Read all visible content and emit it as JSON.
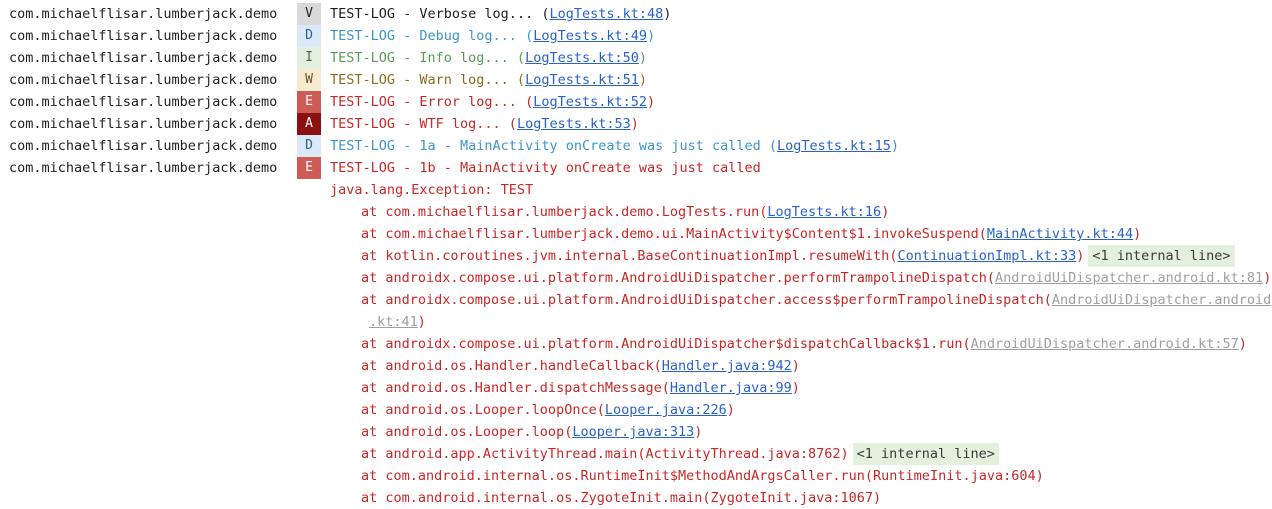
{
  "colors": {
    "error_text": "#c62828",
    "link_blue": "#2a62c9",
    "link_gray": "#a0a0a0",
    "internal_badge_bg": "#e3f1dc"
  },
  "log_rows": [
    {
      "package": "com.michaelflisar.lumberjack.demo",
      "level": "V",
      "message": "TEST-LOG - Verbose log... (",
      "link": "LogTests.kt:48",
      "suffix": ")"
    },
    {
      "package": "com.michaelflisar.lumberjack.demo",
      "level": "D",
      "message": "TEST-LOG - Debug log... (",
      "link": "LogTests.kt:49",
      "suffix": ")"
    },
    {
      "package": "com.michaelflisar.lumberjack.demo",
      "level": "I",
      "message": "TEST-LOG - Info log... (",
      "link": "LogTests.kt:50",
      "suffix": ")"
    },
    {
      "package": "com.michaelflisar.lumberjack.demo",
      "level": "W",
      "message": "TEST-LOG - Warn log... (",
      "link": "LogTests.kt:51",
      "suffix": ")"
    },
    {
      "package": "com.michaelflisar.lumberjack.demo",
      "level": "E",
      "message": "TEST-LOG - Error log... (",
      "link": "LogTests.kt:52",
      "suffix": ")"
    },
    {
      "package": "com.michaelflisar.lumberjack.demo",
      "level": "A",
      "message": "TEST-LOG - WTF log... (",
      "link": "LogTests.kt:53",
      "suffix": ")"
    },
    {
      "package": "com.michaelflisar.lumberjack.demo",
      "level": "D",
      "message": "TEST-LOG - 1a - MainActivity onCreate was just called (",
      "link": "LogTests.kt:15",
      "suffix": ")"
    },
    {
      "package": "com.michaelflisar.lumberjack.demo",
      "level": "E",
      "message": "TEST-LOG - 1b - MainActivity onCreate was just called",
      "link": "",
      "suffix": ""
    }
  ],
  "exception_header": "java.lang.Exception: TEST",
  "stack_trace": [
    {
      "prefix": "at com.michaelflisar.lumberjack.demo.LogTests.run(",
      "link": "LogTests.kt:16",
      "link_style": "blue",
      "suffix": ")",
      "internal": ""
    },
    {
      "prefix": "at com.michaelflisar.lumberjack.demo.ui.MainActivity$Content$1.invokeSuspend(",
      "link": "MainActivity.kt:44",
      "link_style": "blue",
      "suffix": ")",
      "internal": ""
    },
    {
      "prefix": "at kotlin.coroutines.jvm.internal.BaseContinuationImpl.resumeWith(",
      "link": "ContinuationImpl.kt:33",
      "link_style": "blue",
      "suffix": ")",
      "internal": "<1 internal line>"
    },
    {
      "prefix": "at androidx.compose.ui.platform.AndroidUiDispatcher.performTrampolineDispatch(",
      "link": "AndroidUiDispatcher.android.kt:81",
      "link_style": "gray",
      "suffix": ")",
      "internal": ""
    },
    {
      "prefix": "at androidx.compose.ui.platform.AndroidUiDispatcher.access$performTrampolineDispatch(",
      "link": "AndroidUiDispatcher.android",
      "link_style": "gray",
      "suffix": "",
      "internal": "",
      "continuation": {
        "link": ".kt:41",
        "suffix": ")"
      }
    },
    {
      "prefix": "at androidx.compose.ui.platform.AndroidUiDispatcher$dispatchCallback$1.run(",
      "link": "AndroidUiDispatcher.android.kt:57",
      "link_style": "gray",
      "suffix": ")",
      "internal": ""
    },
    {
      "prefix": "at android.os.Handler.handleCallback(",
      "link": "Handler.java:942",
      "link_style": "blue",
      "suffix": ")",
      "internal": ""
    },
    {
      "prefix": "at android.os.Handler.dispatchMessage(",
      "link": "Handler.java:99",
      "link_style": "blue",
      "suffix": ")",
      "internal": ""
    },
    {
      "prefix": "at android.os.Looper.loopOnce(",
      "link": "Looper.java:226",
      "link_style": "blue",
      "suffix": ")",
      "internal": ""
    },
    {
      "prefix": "at android.os.Looper.loop(",
      "link": "Looper.java:313",
      "link_style": "blue",
      "suffix": ")",
      "internal": ""
    },
    {
      "prefix": "at android.app.ActivityThread.main(ActivityThread.java:8762)",
      "link": "",
      "link_style": "",
      "suffix": "",
      "internal": "<1 internal line>"
    },
    {
      "prefix": "at com.android.internal.os.RuntimeInit$MethodAndArgsCaller.run(RuntimeInit.java:604)",
      "link": "",
      "link_style": "",
      "suffix": "",
      "internal": ""
    },
    {
      "prefix": "at com.android.internal.os.ZygoteInit.main(ZygoteInit.java:1067)",
      "link": "",
      "link_style": "",
      "suffix": "",
      "internal": ""
    }
  ]
}
